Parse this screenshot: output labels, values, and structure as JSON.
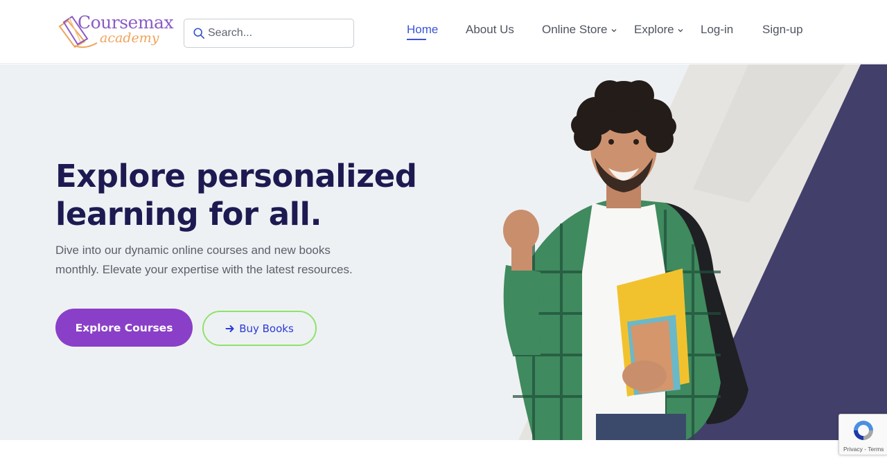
{
  "brand": {
    "name_line1": "Coursemax",
    "name_line2": "academy",
    "colors": {
      "primary": "#8a3fc8",
      "accent": "#3a55d6",
      "dark": "#1d1a52",
      "green": "#8de36b",
      "orange": "#f0a35a"
    }
  },
  "search": {
    "placeholder": "Search...",
    "value": ""
  },
  "nav": {
    "items": [
      {
        "label": "Home",
        "active": true
      },
      {
        "label": "About Us"
      },
      {
        "label": "Online Store",
        "dropdown": true
      },
      {
        "label": "Explore",
        "dropdown": true
      },
      {
        "label": "Log-in"
      },
      {
        "label": "Sign-up"
      }
    ]
  },
  "hero": {
    "title_line1": "Explore personalized",
    "title_line2": "learning for all.",
    "description": "Dive into our dynamic online courses and new books monthly. Elevate your expertise with the latest resources.",
    "primary_button": "Explore Courses",
    "secondary_button": "Buy Books"
  },
  "recaptcha": {
    "privacy": "Privacy",
    "sep": " - ",
    "terms": "Terms"
  }
}
